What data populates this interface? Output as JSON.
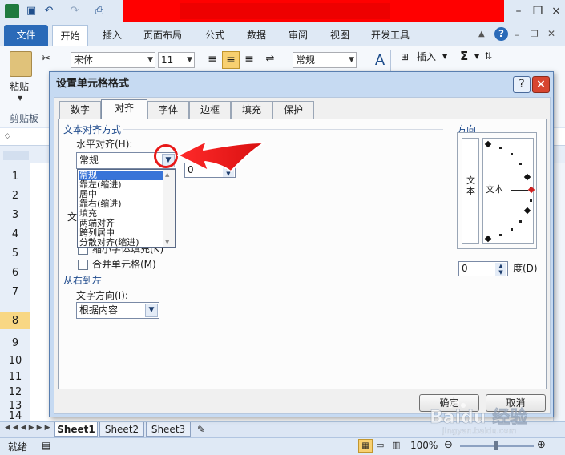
{
  "window": {
    "close_glyph": "×",
    "qat": {
      "save_icon": "save-icon",
      "undo_icon": "undo-icon",
      "redo_icon": "redo-icon"
    }
  },
  "ribbon": {
    "tabs": [
      {
        "label": "文件"
      },
      {
        "label": "开始"
      },
      {
        "label": "插入"
      },
      {
        "label": "页面布局"
      },
      {
        "label": "公式"
      },
      {
        "label": "数据"
      },
      {
        "label": "审阅"
      },
      {
        "label": "视图"
      },
      {
        "label": "开发工具"
      }
    ],
    "paste_label": "粘贴",
    "clipboard_label": "剪贴板",
    "font_name": "宋体",
    "font_size": "11",
    "number_format": "常规",
    "insert_label": "插入",
    "sigma": "Σ"
  },
  "sheet": {
    "row_numbers": [
      "1",
      "2",
      "3",
      "4",
      "5",
      "6",
      "7",
      "8",
      "9",
      "10",
      "11",
      "12",
      "13",
      "14"
    ],
    "tabs": [
      "Sheet1",
      "Sheet2",
      "Sheet3"
    ],
    "status": "就绪",
    "zoom": "100%"
  },
  "dialog": {
    "title": "设置单元格格式",
    "help": "?",
    "close": "×",
    "tabs": [
      "数字",
      "对齐",
      "字体",
      "边框",
      "填充",
      "保护"
    ],
    "active_tab": "对齐",
    "text_align_section": "文本对齐方式",
    "horizontal_label": "水平对齐(H):",
    "horizontal_value": "常规",
    "horizontal_options": [
      "常规",
      "靠左(缩进)",
      "居中",
      "靠右(缩进)",
      "填充",
      "两端对齐",
      "跨列居中",
      "分散对齐(缩进)"
    ],
    "indent_value": "0",
    "partial_section": "文",
    "shrink_label": "缩小字体填充(K)",
    "merge_label": "合并单元格(M)",
    "rtl_section": "从右到左",
    "text_direction_label": "文字方向(I):",
    "text_direction_value": "根据内容",
    "orientation_section": "方向",
    "orientation_vertical_text": "文本",
    "orientation_horizontal_text": "文本",
    "degrees_value": "0",
    "degrees_label": "度(D)",
    "ok": "确定",
    "cancel": "取消"
  },
  "watermark": {
    "brand": "Baidu 经验",
    "url": "jingyan.baidu.com"
  },
  "colors": {
    "accent": "#2a6ab8",
    "annotation": "#e81818",
    "selection": "#3874d8"
  }
}
